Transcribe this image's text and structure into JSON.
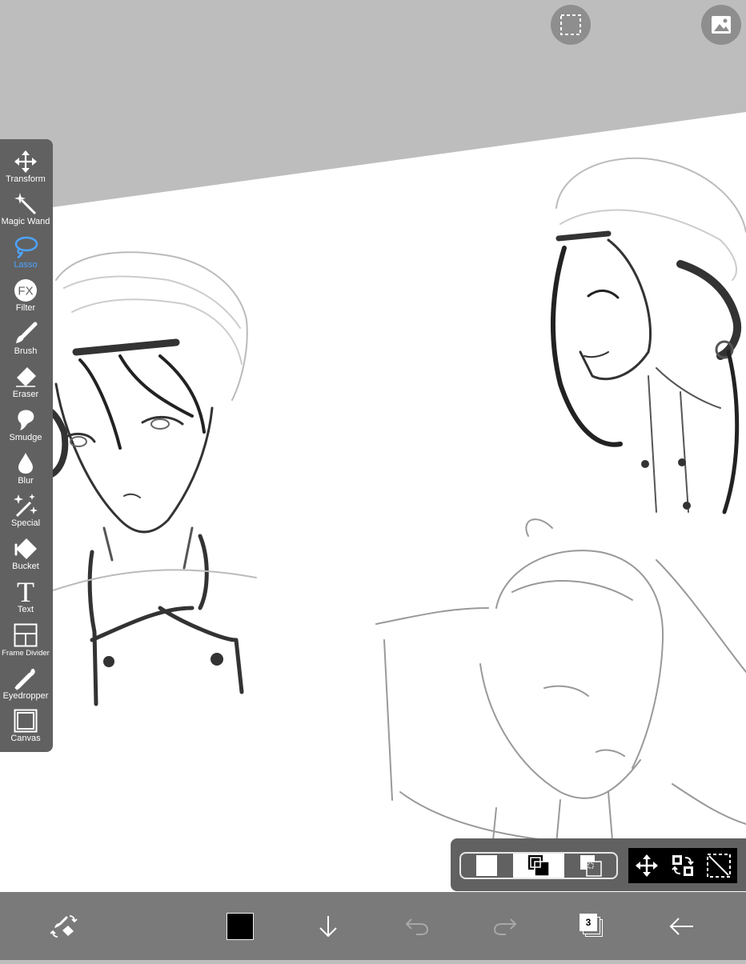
{
  "app": {
    "canvas_bg": "#ffffff",
    "workspace_bg": "#bdbdbd",
    "accent": "#4da3ff"
  },
  "top_buttons": [
    {
      "icon": "selection-icon"
    },
    {
      "icon": "image-gallery-icon"
    }
  ],
  "tools": [
    {
      "id": "transform",
      "label": "Transform",
      "icon": "move-arrows-icon"
    },
    {
      "id": "magic-wand",
      "label": "Magic Wand",
      "icon": "magic-wand-icon"
    },
    {
      "id": "lasso",
      "label": "Lasso",
      "icon": "lasso-icon",
      "active": true
    },
    {
      "id": "filter",
      "label": "Filter",
      "icon": "fx-icon",
      "glyph": "FX"
    },
    {
      "id": "brush",
      "label": "Brush",
      "icon": "brush-icon"
    },
    {
      "id": "eraser",
      "label": "Eraser",
      "icon": "eraser-icon"
    },
    {
      "id": "smudge",
      "label": "Smudge",
      "icon": "smudge-icon"
    },
    {
      "id": "blur",
      "label": "Blur",
      "icon": "blur-drop-icon"
    },
    {
      "id": "special",
      "label": "Special",
      "icon": "sparkle-icon"
    },
    {
      "id": "bucket",
      "label": "Bucket",
      "icon": "bucket-icon"
    },
    {
      "id": "text",
      "label": "Text",
      "icon": "text-icon",
      "glyph": "T"
    },
    {
      "id": "frame-divider",
      "label": "Frame Divider",
      "icon": "frame-divider-icon"
    },
    {
      "id": "eyedropper",
      "label": "Eyedropper",
      "icon": "eyedropper-icon"
    },
    {
      "id": "canvas",
      "label": "Canvas",
      "icon": "canvas-icon"
    }
  ],
  "selection_panel": {
    "modes": [
      "new-selection-icon",
      "add-selection-icon",
      "subtract-selection-icon"
    ],
    "actions": [
      "move-selection-icon",
      "invert-selection-icon",
      "clear-selection-icon"
    ]
  },
  "bottom_bar": {
    "primary_color": "#000000",
    "layer_count": "3",
    "items": [
      "brush-eraser-swap-icon",
      "color-swatch",
      "download-arrow-icon",
      "undo-icon",
      "redo-icon",
      "layers-icon",
      "back-arrow-icon"
    ]
  }
}
